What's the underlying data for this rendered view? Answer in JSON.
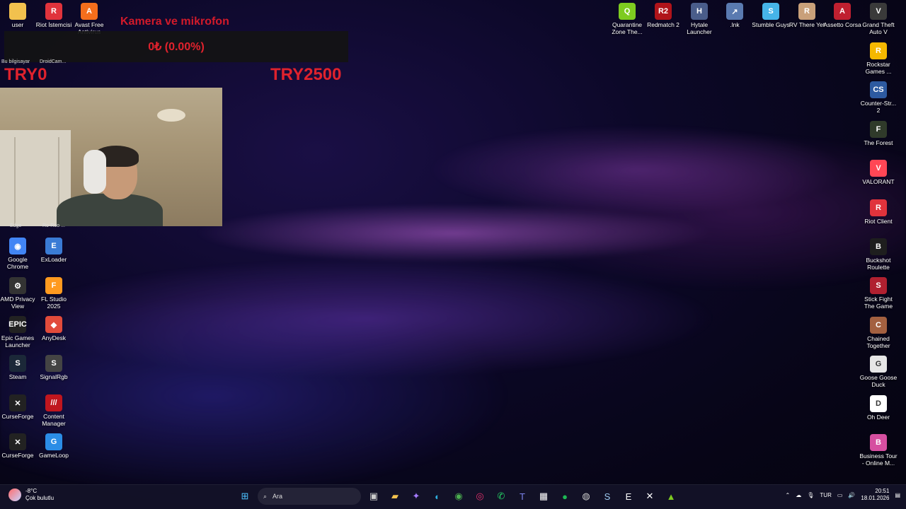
{
  "overlay": {
    "title": "Kamera ve mikrofon",
    "donation_amount": "0₺ (0.00%)",
    "goal_current": "TRY0",
    "goal_target": "TRY2500",
    "partial_labels": [
      "Bu bilgisayar",
      "DroidCam...",
      "Edge",
      "Ro-Roo ..."
    ]
  },
  "desktop_left": [
    {
      "label": "user",
      "icon": "folder-icon",
      "color": "#f2c14e",
      "glyph": ""
    },
    {
      "label": "Riot İstemcisi",
      "icon": "riot-client-icon",
      "color": "#e0333c",
      "glyph": "R"
    },
    {
      "label": "Avast Free Antivirus",
      "icon": "avast-icon",
      "color": "#f46e1c",
      "glyph": "A"
    },
    {
      "label": "Google Chrome",
      "icon": "chrome-icon",
      "color": "#4285f4",
      "glyph": "◉"
    },
    {
      "label": "ExLoader",
      "icon": "exloader-icon",
      "color": "#3a7bd5",
      "glyph": "E"
    },
    {
      "label": "AMD Privacy View",
      "icon": "amd-icon",
      "color": "#333333",
      "glyph": "⚙"
    },
    {
      "label": "FL Studio 2025",
      "icon": "fl-studio-icon",
      "color": "#ff9a1f",
      "glyph": "F"
    },
    {
      "label": "Epic Games Launcher",
      "icon": "epic-games-icon",
      "color": "#222222",
      "glyph": "EPIC"
    },
    {
      "label": "AnyDesk",
      "icon": "anydesk-icon",
      "color": "#e24b3b",
      "glyph": "◆"
    },
    {
      "label": "Steam",
      "icon": "steam-icon",
      "color": "#1b2838",
      "glyph": "S"
    },
    {
      "label": "SignalRgb",
      "icon": "signalrgb-icon",
      "color": "#444444",
      "glyph": "S"
    },
    {
      "label": "CurseForge",
      "icon": "curseforge-icon",
      "color": "#222222",
      "glyph": "✕"
    },
    {
      "label": "Content Manager",
      "icon": "content-manager-icon",
      "color": "#c0161e",
      "glyph": "///"
    },
    {
      "label": "CurseForge",
      "icon": "curseforge-icon",
      "color": "#222222",
      "glyph": "✕"
    },
    {
      "label": "GameLoop",
      "icon": "gameloop-icon",
      "color": "#2b8de6",
      "glyph": "G"
    }
  ],
  "desktop_top": [
    {
      "label": "Quarantine Zone The...",
      "icon": "quarantine-zone-icon",
      "color": "#7ecb20",
      "glyph": "Q"
    },
    {
      "label": "Redmatch 2",
      "icon": "redmatch-icon",
      "color": "#b0141a",
      "glyph": "R2"
    },
    {
      "label": "Hytale Launcher",
      "icon": "hytale-icon",
      "color": "#4a5d8a",
      "glyph": "H"
    },
    {
      "label": ".lnk",
      "icon": "shortcut-icon",
      "color": "#5a7ab0",
      "glyph": "↗"
    },
    {
      "label": "Stumble Guys",
      "icon": "stumble-guys-icon",
      "color": "#46b4e8",
      "glyph": "S"
    },
    {
      "label": "RV There Yet",
      "icon": "rv-there-yet-icon",
      "color": "#c9a07a",
      "glyph": "R"
    },
    {
      "label": "Assetto Corsa",
      "icon": "assetto-corsa-icon",
      "color": "#c02030",
      "glyph": "A"
    },
    {
      "label": "Grand Theft Auto V",
      "icon": "gta-v-icon",
      "color": "#3a3a3a",
      "glyph": "V"
    }
  ],
  "desktop_right": [
    {
      "label": "Rockstar Games ...",
      "icon": "rockstar-icon",
      "color": "#f5b800",
      "glyph": "R"
    },
    {
      "label": "Counter-Str... 2",
      "icon": "counter-strike-icon",
      "color": "#2d5aa0",
      "glyph": "CS"
    },
    {
      "label": "The Forest",
      "icon": "the-forest-icon",
      "color": "#2f3a2a",
      "glyph": "F"
    },
    {
      "label": "VALORANT",
      "icon": "valorant-icon",
      "color": "#ff4655",
      "glyph": "V"
    },
    {
      "label": "Riot Client",
      "icon": "riot-client-icon",
      "color": "#e0333c",
      "glyph": "R"
    },
    {
      "label": "Buckshot Roulette",
      "icon": "buckshot-roulette-icon",
      "color": "#1e1e1e",
      "glyph": "B"
    },
    {
      "label": "Stick Fight The Game",
      "icon": "stick-fight-icon",
      "color": "#b02030",
      "glyph": "S"
    },
    {
      "label": "Chained Together",
      "icon": "chained-together-icon",
      "color": "#a36040",
      "glyph": "C"
    },
    {
      "label": "Goose Goose Duck",
      "icon": "goose-goose-duck-icon",
      "color": "#e6e6e6",
      "glyph": "G"
    },
    {
      "label": "Oh Deer",
      "icon": "oh-deer-icon",
      "color": "#ffffff",
      "glyph": "D"
    },
    {
      "label": "Business Tour - Online M...",
      "icon": "business-tour-icon",
      "color": "#d64fa0",
      "glyph": "B"
    }
  ],
  "taskbar": {
    "weather_temp": "-8°C",
    "weather_desc": "Çok bulutlu",
    "search_placeholder": "Ara",
    "language": "TUR",
    "time": "20:51",
    "date": "18.01.2026",
    "apps": [
      {
        "name": "start-button",
        "glyph": "⊞",
        "color": "#4cc2ff"
      },
      {
        "name": "task-view-icon",
        "glyph": "▣",
        "color": "#cccccc"
      },
      {
        "name": "file-explorer-icon",
        "glyph": "▰",
        "color": "#f2c14e"
      },
      {
        "name": "copilot-icon",
        "glyph": "✦",
        "color": "#a57bff"
      },
      {
        "name": "edge-icon",
        "glyph": "◐",
        "color": "#2fb0e0"
      },
      {
        "name": "chrome-icon",
        "glyph": "◉",
        "color": "#4caf50"
      },
      {
        "name": "instagram-icon",
        "glyph": "◎",
        "color": "#e1306c"
      },
      {
        "name": "whatsapp-icon",
        "glyph": "✆",
        "color": "#25d366"
      },
      {
        "name": "teams-icon",
        "glyph": "T",
        "color": "#7b83eb"
      },
      {
        "name": "store-icon",
        "glyph": "▦",
        "color": "#ffffff"
      },
      {
        "name": "spotify-icon",
        "glyph": "●",
        "color": "#1db954"
      },
      {
        "name": "obs-icon",
        "glyph": "◍",
        "color": "#cccccc"
      },
      {
        "name": "steam-icon",
        "glyph": "S",
        "color": "#9ecbf2"
      },
      {
        "name": "epic-games-icon",
        "glyph": "E",
        "color": "#ffffff"
      },
      {
        "name": "curseforge-icon",
        "glyph": "✕",
        "color": "#ffffff"
      },
      {
        "name": "android-icon",
        "glyph": "▲",
        "color": "#7ecb20"
      }
    ]
  }
}
